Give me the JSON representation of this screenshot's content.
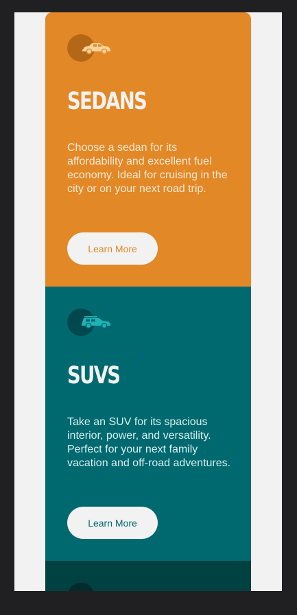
{
  "cards": [
    {
      "id": "sedans",
      "title": "SEDANS",
      "description": "Choose a sedan for its affordability and excellent fuel economy. Ideal for cruising in the city or on your next road trip.",
      "button_label": "Learn More",
      "icon": "sedan-icon",
      "background": "#e38826",
      "icon_color": "#fdd39a"
    },
    {
      "id": "suvs",
      "title": "SUVS",
      "description": "Take an SUV for its spacious interior, power, and versatility. Perfect for your next family vacation and off-road adventures.",
      "button_label": "Learn More",
      "icon": "suv-icon",
      "background": "#006970",
      "icon_color": "#1fb3b8"
    },
    {
      "id": "luxury",
      "background": "#004141",
      "icon": "luxury-car-icon"
    }
  ],
  "colors": {
    "page_background": "#f2f2f2",
    "frame_background": "#202023",
    "text_light": "#f2f2f2"
  }
}
